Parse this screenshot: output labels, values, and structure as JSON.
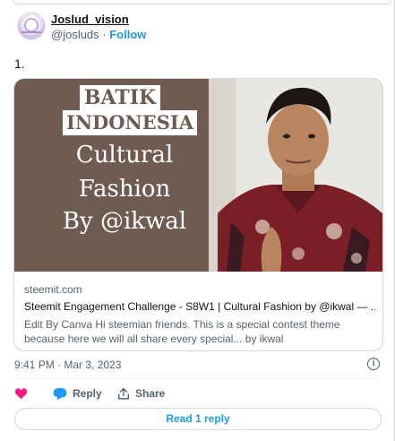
{
  "author": {
    "name": "Joslud_vision",
    "handle": "@josluds",
    "separator": " · ",
    "follow_label": "Follow"
  },
  "tweet": {
    "text": "1."
  },
  "card": {
    "image": {
      "line1": "BATIK",
      "line2": "INDONESIA",
      "line3": "Cultural",
      "line4": "Fashion",
      "line5": "By @ikwal"
    },
    "domain": "steemit.com",
    "title": "Steemit Engagement Challenge - S8W1 | Cultural Fashion by @ikwal — ...",
    "description": "Edit By Canva Hi steemian friends. This is a special contest theme because here we will all share every special... by ikwal"
  },
  "timestamp": "9:41 PM · Mar 3, 2023",
  "actions": {
    "reply_label": "Reply",
    "share_label": "Share"
  },
  "read_replies_label": "Read 1 reply",
  "colors": {
    "accent": "#1d9bf0",
    "like": "#f91880",
    "card_bg": "#6f5b52"
  }
}
